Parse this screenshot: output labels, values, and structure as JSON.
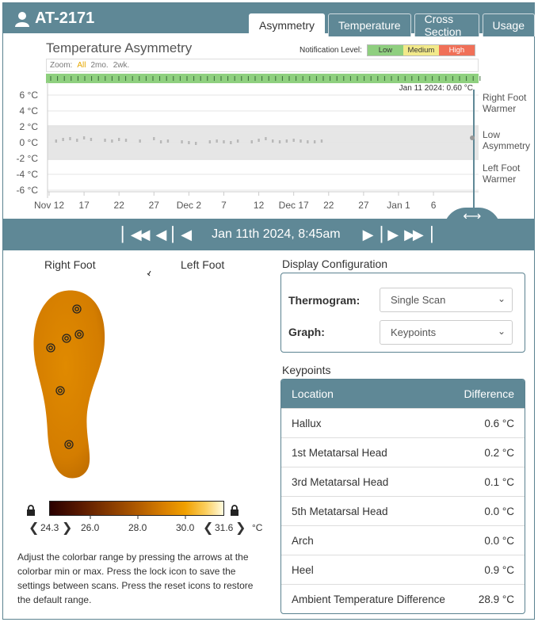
{
  "header": {
    "patient_id": "AT-2171",
    "tabs": [
      {
        "label": "Asymmetry",
        "active": true
      },
      {
        "label": "Temperature",
        "active": false
      },
      {
        "label": "Cross Section",
        "active": false
      },
      {
        "label": "Usage",
        "active": false
      }
    ]
  },
  "chart": {
    "title": "Temperature Asymmetry",
    "notification_label": "Notification Level:",
    "levels": [
      {
        "label": "Low",
        "color": "#8fcf7f"
      },
      {
        "label": "Medium",
        "color": "#f2e98a"
      },
      {
        "label": "High",
        "color": "#f07058"
      }
    ],
    "zoom_label": "Zoom:",
    "zoom_options": [
      "All",
      "2mo.",
      "2wk."
    ],
    "zoom_selected": "All",
    "tooltip": "Jan 11 2024:  0.60 °C",
    "right_labels": [
      "Right Foot",
      "Warmer",
      "Low",
      "Asymmetry",
      "Left Foot",
      "Warmer"
    ]
  },
  "chart_data": {
    "type": "scatter",
    "title": "Temperature Asymmetry",
    "y_ticks": [
      "6 °C",
      "4 °C",
      "2 °C",
      "0 °C",
      "-2 °C",
      "-4 °C",
      "-6 °C"
    ],
    "ylim": [
      -7,
      7
    ],
    "x_ticks": [
      "Nov 12",
      "17",
      "22",
      "27",
      "Dec 2",
      "7",
      "12",
      "Dec 17",
      "22",
      "27",
      "Jan 1",
      "6"
    ],
    "band": [
      -2.2,
      2.2
    ],
    "points_day_offset_from_nov_11": [
      2,
      3,
      4,
      5,
      6,
      7,
      9,
      10,
      11,
      12,
      14,
      16,
      17,
      18,
      20,
      21,
      22,
      24,
      25,
      26,
      27,
      28,
      30,
      31,
      32,
      33,
      34,
      35,
      36,
      37,
      38,
      39,
      40,
      41,
      43,
      44,
      45,
      46,
      47,
      48,
      49,
      50,
      51,
      52,
      53,
      54,
      55,
      56,
      57,
      58,
      59,
      60,
      61
    ],
    "selected_point": {
      "date": "Jan 11 2024",
      "value": 0.6
    },
    "grid": true
  },
  "nav": {
    "date": "Jan 11th 2024, 8:45am"
  },
  "feet": {
    "right_label": "Right Foot",
    "left_label": "Left Foot"
  },
  "colorbar": {
    "min": "24.3",
    "max": "31.6",
    "ticks": [
      "26.0",
      "28.0",
      "30.0"
    ],
    "unit": "°C",
    "help": "Adjust the colorbar range by pressing the arrows at the colorbar min or max. Press the lock icon to save the settings between scans. Press the reset icons to restore the default range."
  },
  "config": {
    "title": "Display Configuration",
    "thermogram_label": "Thermogram:",
    "thermogram_value": "Single Scan",
    "graph_label": "Graph:",
    "graph_value": "Keypoints"
  },
  "keypoints": {
    "title": "Keypoints",
    "col_location": "Location",
    "col_difference": "Difference",
    "rows": [
      {
        "location": "Hallux",
        "difference": "0.6 °C"
      },
      {
        "location": "1st Metatarsal Head",
        "difference": "0.2 °C"
      },
      {
        "location": "3rd Metatarsal Head",
        "difference": "0.1 °C"
      },
      {
        "location": "5th Metatarsal Head",
        "difference": "0.0 °C"
      },
      {
        "location": "Arch",
        "difference": "0.0 °C"
      },
      {
        "location": "Heel",
        "difference": "0.9 °C"
      },
      {
        "location": "Ambient Temperature Difference",
        "difference": "28.9 °C"
      }
    ]
  }
}
